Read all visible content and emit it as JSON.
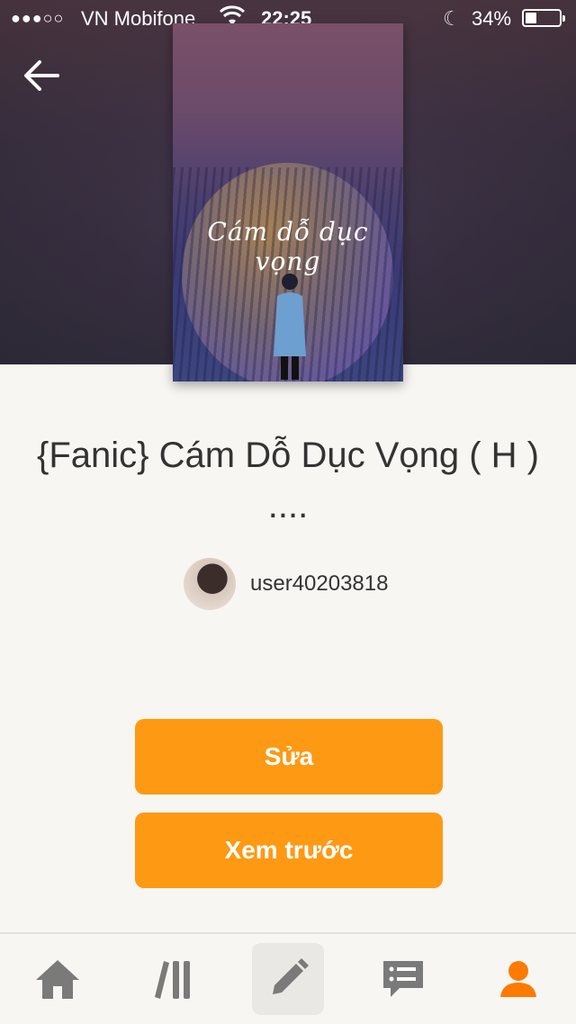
{
  "status_bar": {
    "signal": "●●●○○",
    "carrier": "VN Mobifone",
    "time": "22:25",
    "battery": "34%"
  },
  "nav": {
    "back_icon": "arrow-left-icon"
  },
  "cover": {
    "title_art": "Cám dỗ dục vọng"
  },
  "story": {
    "title": "{Fanic} Cám Dỗ Dục Vọng ( H ) ....",
    "author": "user40203818"
  },
  "actions": {
    "edit_label": "Sửa",
    "preview_label": "Xem trước"
  },
  "tabbar": {
    "items": [
      {
        "icon": "home-icon"
      },
      {
        "icon": "library-icon"
      },
      {
        "icon": "pencil-icon",
        "selected": true
      },
      {
        "icon": "chat-icon"
      },
      {
        "icon": "profile-icon"
      }
    ]
  },
  "colors": {
    "accent": "#fe9913",
    "tab_icon": "#7a7a7a",
    "tab_active": "#fe7a00"
  }
}
